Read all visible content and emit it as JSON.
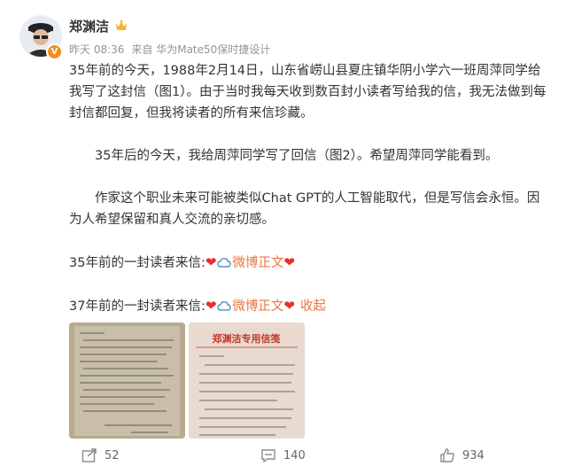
{
  "author": {
    "name": "郑渊洁",
    "avatar_badge": "V"
  },
  "meta": {
    "time": "昨天 08:36",
    "source": "来自 华为Mate50保时捷设计"
  },
  "content": {
    "p1": "35年前的今天，1988年2月14日，山东省崂山县夏庄镇华阴小学六一班周萍同学给我写了这封信（图1）。由于当时我每天收到数百封小读者写给我的信，我无法做到每封信都回复，但我将读者的所有来信珍藏。",
    "p2": "35年后的今天，我给周萍同学写了回信（图2）。希望周萍同学能看到。",
    "p3": "作家这个职业未来可能被类似Chat GPT的人工智能取代，但是写信会永恒。因为人希望保留和真人交流的亲切感。",
    "line4_prefix": "35年前的一封读者来信:",
    "line5_prefix": "37年前的一封读者来信:",
    "heart": "❤",
    "weibo_link": "微博正文",
    "collapse": "收起"
  },
  "images": {
    "img2_header": "郑渊洁专用信笺"
  },
  "actions": {
    "repost_count": "52",
    "comment_count": "140",
    "like_count": "934"
  },
  "colors": {
    "accent": "#eb7340",
    "heart": "#e8302a",
    "meta": "#939393"
  }
}
